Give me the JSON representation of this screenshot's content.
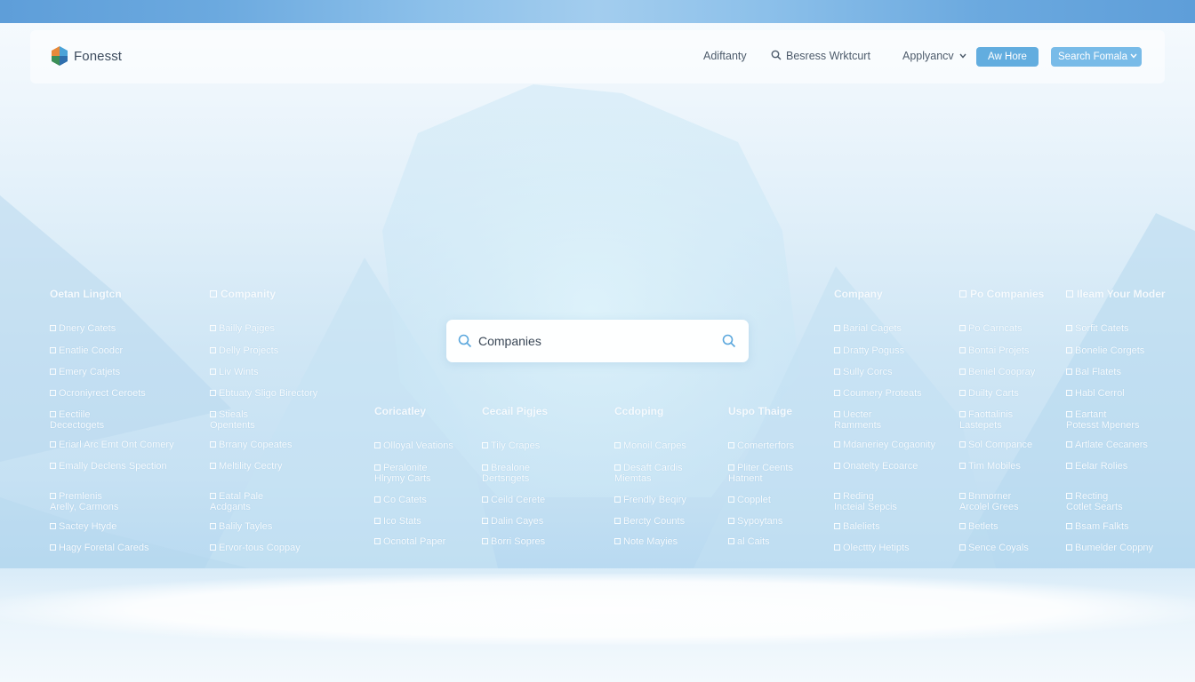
{
  "brand": {
    "name": "Fonesst"
  },
  "nav": {
    "link1": "Adiftanty",
    "link2": "Besress Wrktcurt",
    "link3": "Applyancv",
    "button_primary": "Aw Hore",
    "button_secondary": "Search Fomala"
  },
  "search": {
    "value": "Companies",
    "placeholder": "Companies"
  },
  "icons": {
    "logo": "logo-icon",
    "search": "search-icon",
    "chevron": "chevron-down-icon",
    "checkbox": "checkbox-icon"
  },
  "colors": {
    "accent": "#62addf",
    "top_band": "#5e9ed9",
    "text": "#3b4a5c"
  },
  "directory": {
    "col1": {
      "heading": "Oetan Lingtcn",
      "items": [
        "Dnery Catets",
        "Enatlie Coodcr",
        "Emery Catjets",
        "Ocroniyrect Ceroets",
        "Eectiile\nDecectogets",
        "Eriarl Arc Emt Ont Comery",
        "Emally Declens Spection",
        "Premlenis\nArelly, Carmons",
        "Sactey Htyde",
        "Hagy Foretal Careds"
      ]
    },
    "col2": {
      "heading": "Companity",
      "items": [
        "Bailly Pajges",
        "Delly Projects",
        "Liv Wints",
        "Ebtuaty Sligo Birectory",
        "Stieals\nOpentents",
        "Brrany Copeates",
        "Meltility Cectry",
        "Eatal Pale\nAcdgants",
        "Balily Tayles",
        "Ervor-tous Coppay"
      ]
    },
    "col3": {
      "heading": "Coricatley",
      "items": [
        "Olloyal Veations",
        "Peralonite\nHlrymy Carts",
        "Co Catets",
        "Ico Stats",
        "Ocnotal Paper"
      ]
    },
    "col4": {
      "heading": "Cecail Pigjes",
      "items": [
        "Tily Crapes",
        "Brealone\nDertsngets",
        "Ceild Cerete",
        "Dalin Cayes",
        "Borri Sopres"
      ]
    },
    "col5": {
      "heading": "Ccdoping",
      "items": [
        "Monoil Carpes",
        "Desaft Cardis\nMiemtas",
        "Frendly Beqiry",
        "Bercty Counts",
        "Note Mayies"
      ]
    },
    "col6": {
      "heading": "Uspo Thaige",
      "items": [
        "Comerterfors",
        "Pliter Ceents\nHatnent",
        "Copplet",
        "Sypoytans",
        "al Caits"
      ]
    },
    "col7": {
      "heading": "Company",
      "items": [
        "Barial Cagets",
        "Dratty Poguss",
        "Sully Corcs",
        "Coumery Proteats",
        "Uecter\nRamments",
        "Mdaneriey Cogaonity",
        "Onatelty Ecoarce",
        "Reding\nIncteial Sepcis",
        "Baleliets",
        "Olecttty Hetipts"
      ]
    },
    "col8": {
      "heading": "Po Companies",
      "items": [
        "Po Carncats",
        "Bontai Projets",
        "Beniel Coopray",
        "Duilty Carts",
        "Faottalinis\nLastepets",
        "Sol Compance",
        "Tim Mobiles",
        "Bnmorner\nArcolel Grees",
        "Betlets",
        "Sence Coyals"
      ]
    },
    "col9": {
      "heading": "Ileam Your Moder",
      "items": [
        "Sorfit Catets",
        "Bonelie Corgets",
        "Bal Flatets",
        "Habl Cerrol",
        "Eartant\nPotesst Mpeners",
        "Artlate Cecaners",
        "Eelar Rolies",
        "Recting\nCotlet Searts",
        "Bsam Falkts",
        "Bumelder Coppny"
      ]
    }
  }
}
